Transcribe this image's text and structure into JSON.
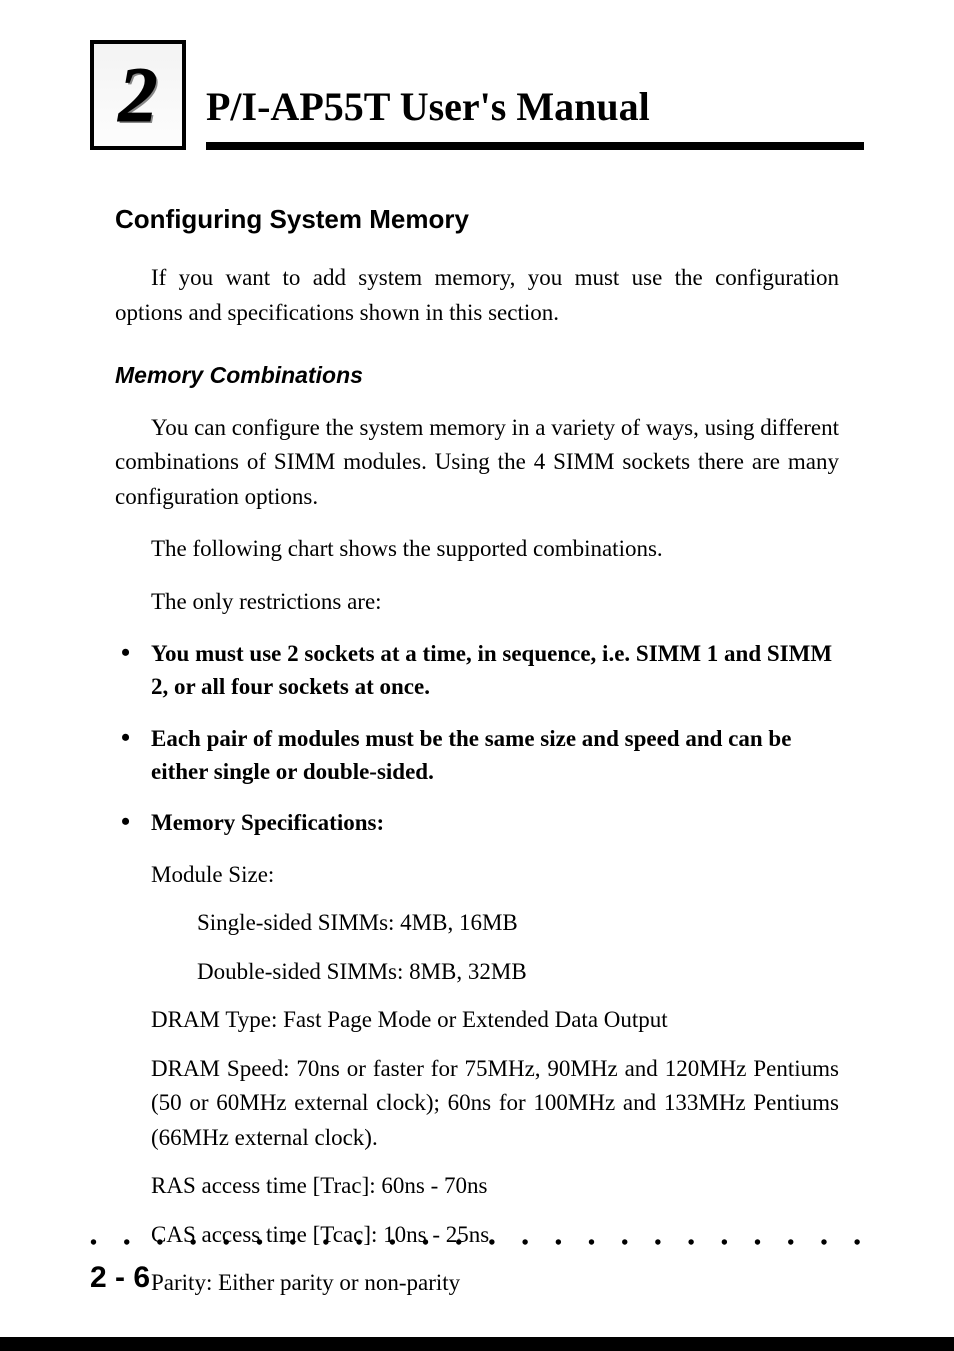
{
  "header": {
    "chapter_number": "2",
    "title": "P/I-AP55T User's Manual"
  },
  "section": {
    "heading": "Configuring System Memory",
    "intro": "If you want to add system memory, you must use the configuration options and specifications shown in this section.",
    "sub_heading": "Memory Combinations",
    "para1": "You can configure the system memory in a variety of ways, using different combinations of SIMM modules. Using the 4 SIMM sockets there are many configuration options.",
    "para2": "The following chart shows the supported combinations.",
    "para3": "The only restrictions are:",
    "bullets": [
      "You must use 2 sockets at a time, in sequence, i.e. SIMM 1 and SIMM 2, or all four sockets at once.",
      "Each pair of modules must be the same size and speed and can be either single or double-sided.",
      "Memory Specifications:"
    ],
    "specs": {
      "module_size_label": "Module Size:",
      "single_sided": "Single-sided SIMMs: 4MB, 16MB",
      "double_sided": "Double-sided SIMMs: 8MB, 32MB",
      "dram_type": "DRAM Type: Fast Page Mode or Extended Data Output",
      "dram_speed": "DRAM Speed: 70ns or faster for 75MHz, 90MHz and 120MHz Pentiums (50 or 60MHz external clock); 60ns for 100MHz and 133MHz Pentiums (66MHz external clock).",
      "ras": "RAS access time [Trac]: 60ns - 70ns",
      "cas": "CAS access time [Tcac]: 10ns - 25ns",
      "parity": "Parity: Either parity or non-parity"
    }
  },
  "footer": {
    "dots": "• • • • • • • • • • • • • • • • • • • • • • • • • • • • • • • • • • • • • • • • •",
    "page_number": "2 - 6"
  }
}
